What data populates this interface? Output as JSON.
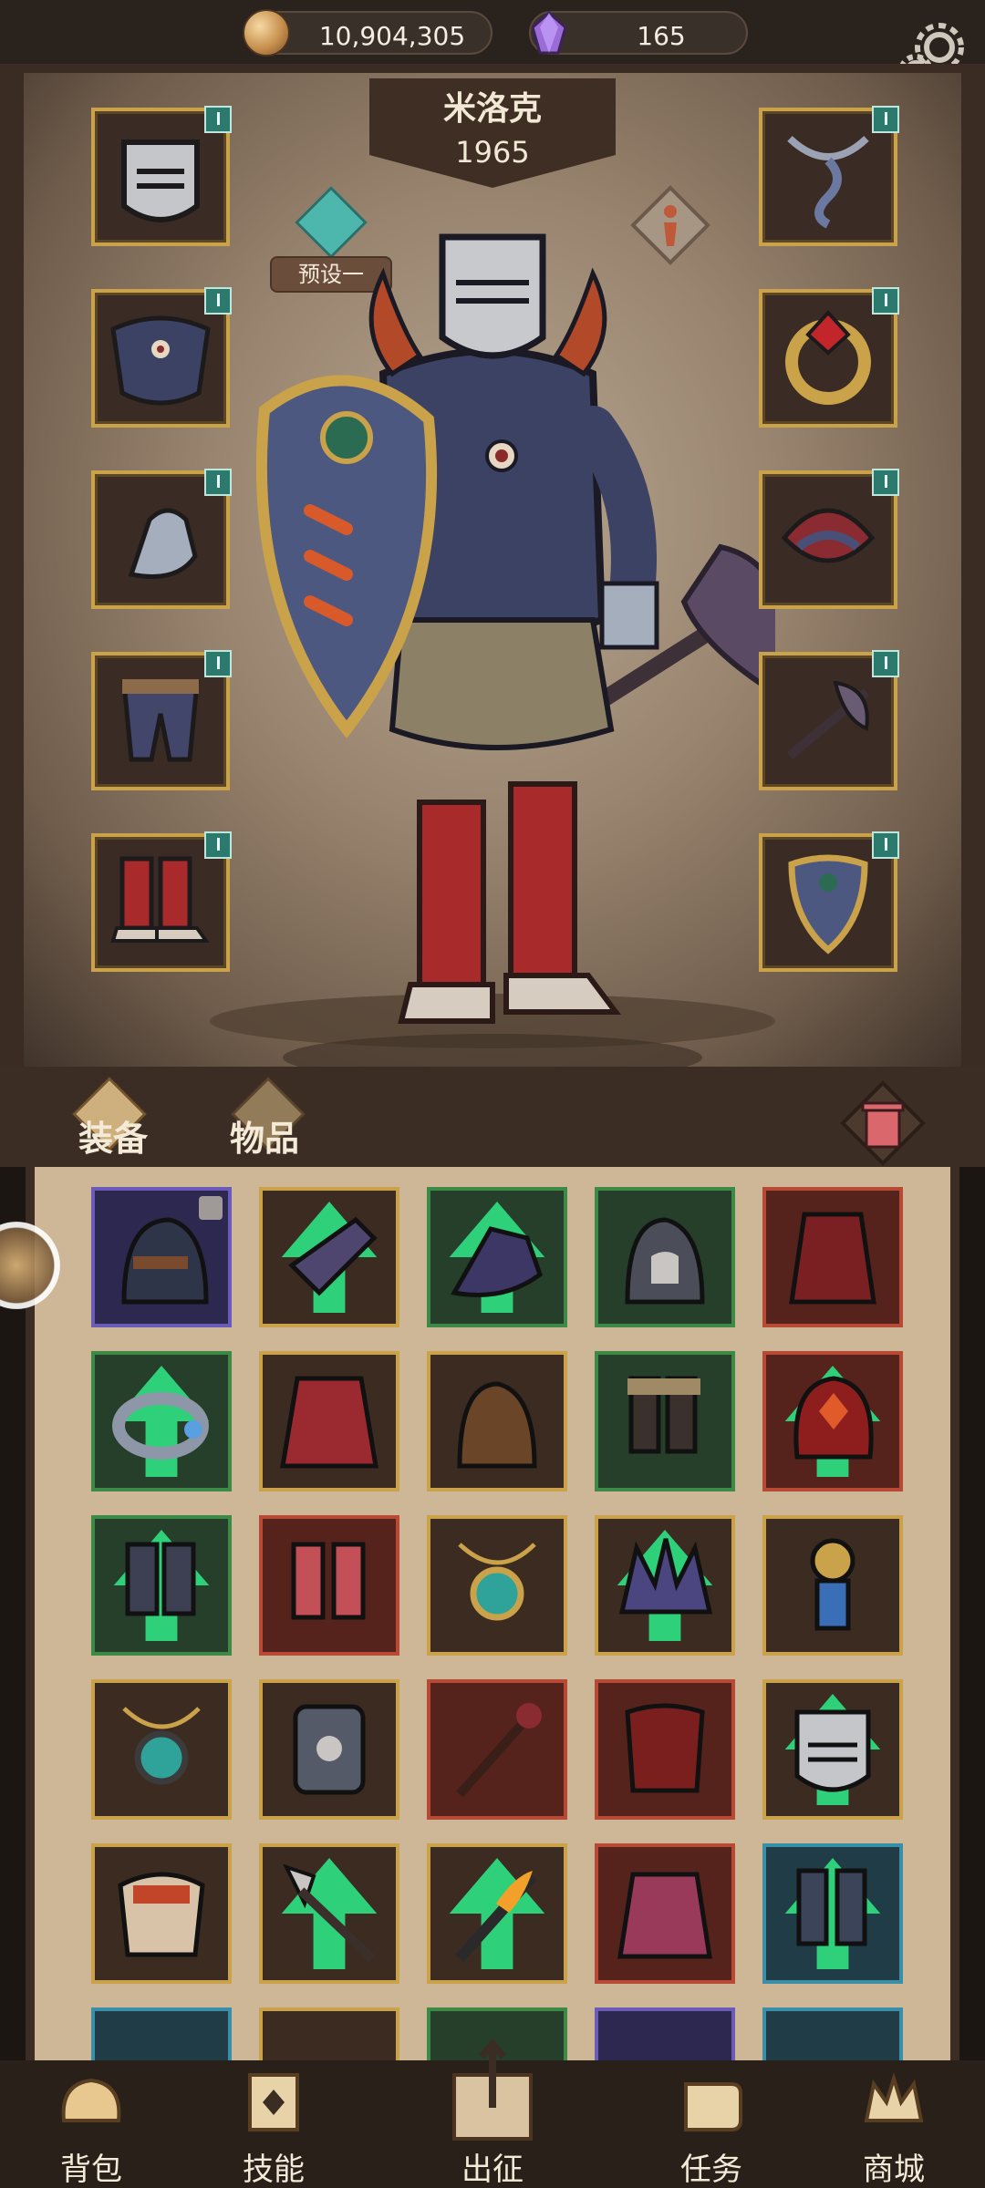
{
  "resources": {
    "gold": "10,904,305",
    "gems": "165"
  },
  "character": {
    "name": "米洛克",
    "power": "1965",
    "preset_label": "预设一"
  },
  "tabs": {
    "equipment": "装备",
    "items": "物品"
  },
  "bottom_nav": [
    {
      "label": "背包",
      "icon": "backpack-icon"
    },
    {
      "label": "技能",
      "icon": "skill-book-icon"
    },
    {
      "label": "出征",
      "icon": "battle-map-icon"
    },
    {
      "label": "任务",
      "icon": "task-scroll-icon"
    },
    {
      "label": "商城",
      "icon": "shop-crown-icon"
    }
  ],
  "colors": {
    "accent_teal": "#2c7a6e",
    "gold_frame": "#c9a24a",
    "upgrade_green": "#2fd07a"
  },
  "equipment_slots_left": [
    "helmet",
    "chest",
    "gloves",
    "pants",
    "boots"
  ],
  "equipment_slots_right": [
    "necklace",
    "ring",
    "shoulder",
    "weapon",
    "shield"
  ],
  "inventory_rarities": [
    [
      "purple",
      "gold",
      "green",
      "green",
      "red"
    ],
    [
      "green",
      "gold",
      "gold",
      "green",
      "red"
    ],
    [
      "green",
      "red",
      "gold",
      "gold",
      "gold"
    ],
    [
      "gold",
      "gold",
      "red",
      "red",
      "gold"
    ],
    [
      "gold",
      "gold",
      "gold",
      "red",
      "blue"
    ]
  ]
}
